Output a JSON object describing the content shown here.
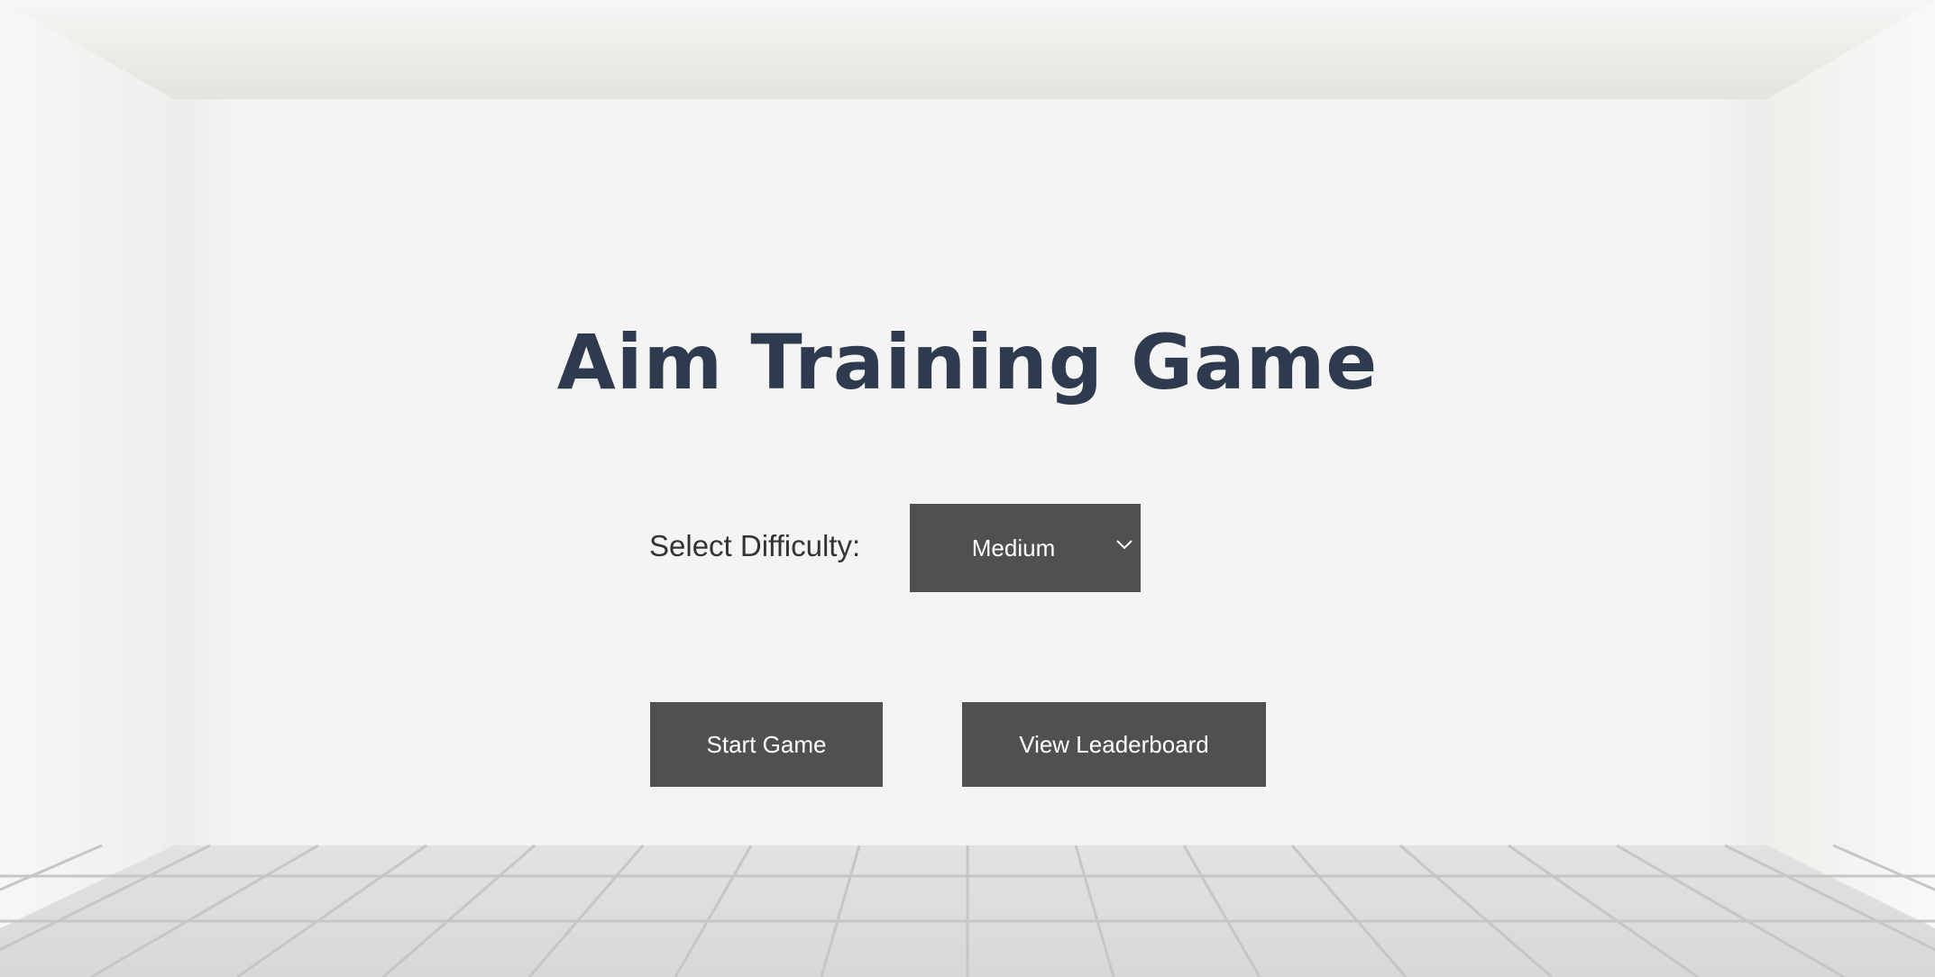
{
  "page": {
    "title": "Aim Training Game"
  },
  "difficulty": {
    "label": "Select Difficulty:",
    "selected": "Medium"
  },
  "buttons": {
    "start": "Start Game",
    "leaderboard": "View Leaderboard"
  },
  "colors": {
    "title": "#2e3a4e",
    "button_bg": "#505050",
    "button_text": "#ffffff",
    "wall": "#f4f4f4",
    "floor": "#dedede",
    "grout": "#c8c8c8"
  }
}
